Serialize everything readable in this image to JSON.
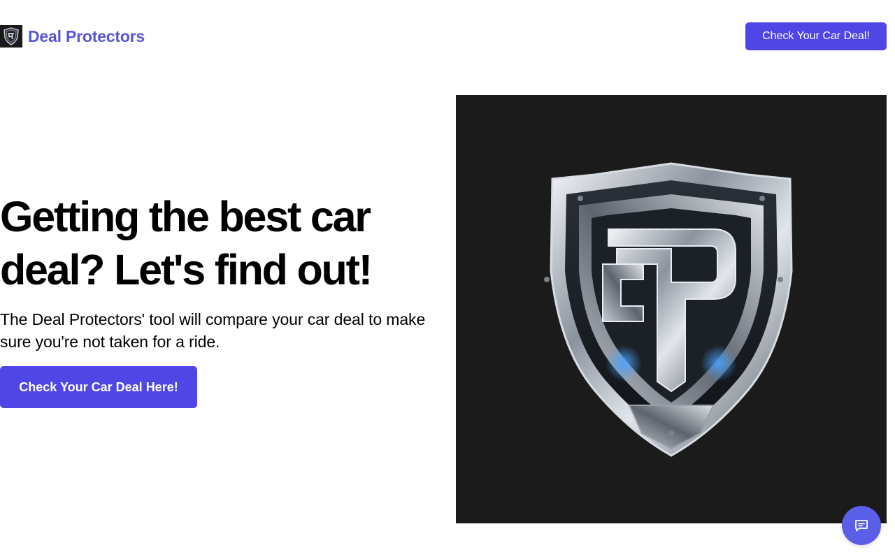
{
  "header": {
    "brand_name": "Deal Protectors",
    "cta_label": "Check Your Car Deal!"
  },
  "hero": {
    "title": "Getting the best car deal? Let's find out!",
    "subtitle": "The Deal Protectors' tool will compare your car deal to make sure you're not taken for a ride.",
    "cta_label": "Check Your Car Deal Here!",
    "image_logo_letters": "DP"
  },
  "chat": {
    "icon": "chat-bubble-icon"
  },
  "colors": {
    "accent": "#4f46e5",
    "brand_text": "#5a55d6",
    "image_background": "#1b1b1b",
    "chat_button": "#5b5fe8"
  }
}
